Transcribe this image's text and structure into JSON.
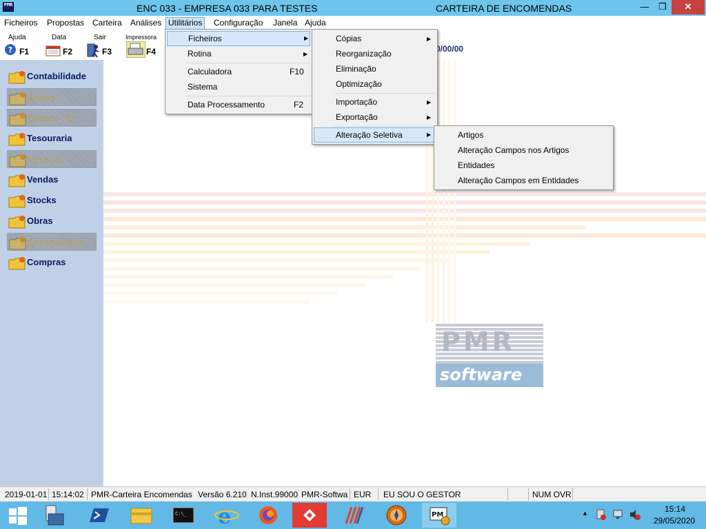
{
  "window": {
    "title_left": "ENC 033 - EMPRESA 033 PARA TESTES",
    "title_right": "CARTEIRA DE ENCOMENDAS",
    "app_icon_text": "PMR"
  },
  "menubar": [
    {
      "label": "Ficheiros"
    },
    {
      "label": "Propostas"
    },
    {
      "label": "Carteira"
    },
    {
      "label": "Análises"
    },
    {
      "label": "Utilitários"
    },
    {
      "label": "Configuração"
    },
    {
      "label": "Janela"
    },
    {
      "label": "Ajuda"
    }
  ],
  "toolbar": {
    "help": {
      "label": "Ajuda",
      "key": "F1"
    },
    "date": {
      "label": "Data",
      "key": "F2"
    },
    "exit": {
      "label": "Sair",
      "key": "F3"
    },
    "printer": {
      "label": "Impressora",
      "key": "F4"
    },
    "date_display": "0/00/00"
  },
  "modules": [
    {
      "label": "Contabilidade",
      "enabled": true
    },
    {
      "label": "Ativos",
      "enabled": false
    },
    {
      "label": "Grupos \"B\"",
      "enabled": false
    },
    {
      "label": "Tesouraria",
      "enabled": true
    },
    {
      "label": "Pessoal",
      "enabled": false
    },
    {
      "label": "Vendas",
      "enabled": true
    },
    {
      "label": "Stocks",
      "enabled": true
    },
    {
      "label": "Obras",
      "enabled": true
    },
    {
      "label": "Encomendas",
      "enabled": false
    },
    {
      "label": "Compras",
      "enabled": true
    }
  ],
  "menu_utilitarios": {
    "ficheiros": "Ficheiros",
    "rotina": "Rotina",
    "calculadora": "Calculadora",
    "calculadora_key": "F10",
    "sistema": "Sistema",
    "data_processamento": "Data Processamento",
    "data_processamento_key": "F2"
  },
  "menu_ficheiros": {
    "copias": "Cópias",
    "reorganizacao": "Reorganização",
    "eliminacao": "Eliminação",
    "optimizacao": "Optimização",
    "importacao": "Importação",
    "exportacao": "Exportação",
    "alteracao_seletiva": "Alteração Seletiva"
  },
  "menu_alteracao": {
    "artigos": "Artigos",
    "alteracao_campos_artigos": "Alteração Campos nos Artigos",
    "entidades": "Entidades",
    "alteracao_campos_entidades": "Alteração Campos em Entidades"
  },
  "logo": {
    "top": "PMR",
    "bottom": "software"
  },
  "statusbar": {
    "date": "2019-01-01",
    "time": "15:14:02",
    "app": "PMR-Carteira Encomendas",
    "version": "Versão  6.210",
    "inst": "N.Inst.99000",
    "company": "PMR-Softwar",
    "currency": "EUR",
    "user": "EU SOU O GESTOR",
    "keys": "NUM OVR"
  },
  "taskbar": {
    "time": "15:14",
    "date": "29/05/2020"
  },
  "colors": {
    "titlebar": "#6ec5ec",
    "left_panel": "#c0d1e7",
    "taskbar": "#63b9e6",
    "menu_highlight": "#d5e7f8"
  }
}
